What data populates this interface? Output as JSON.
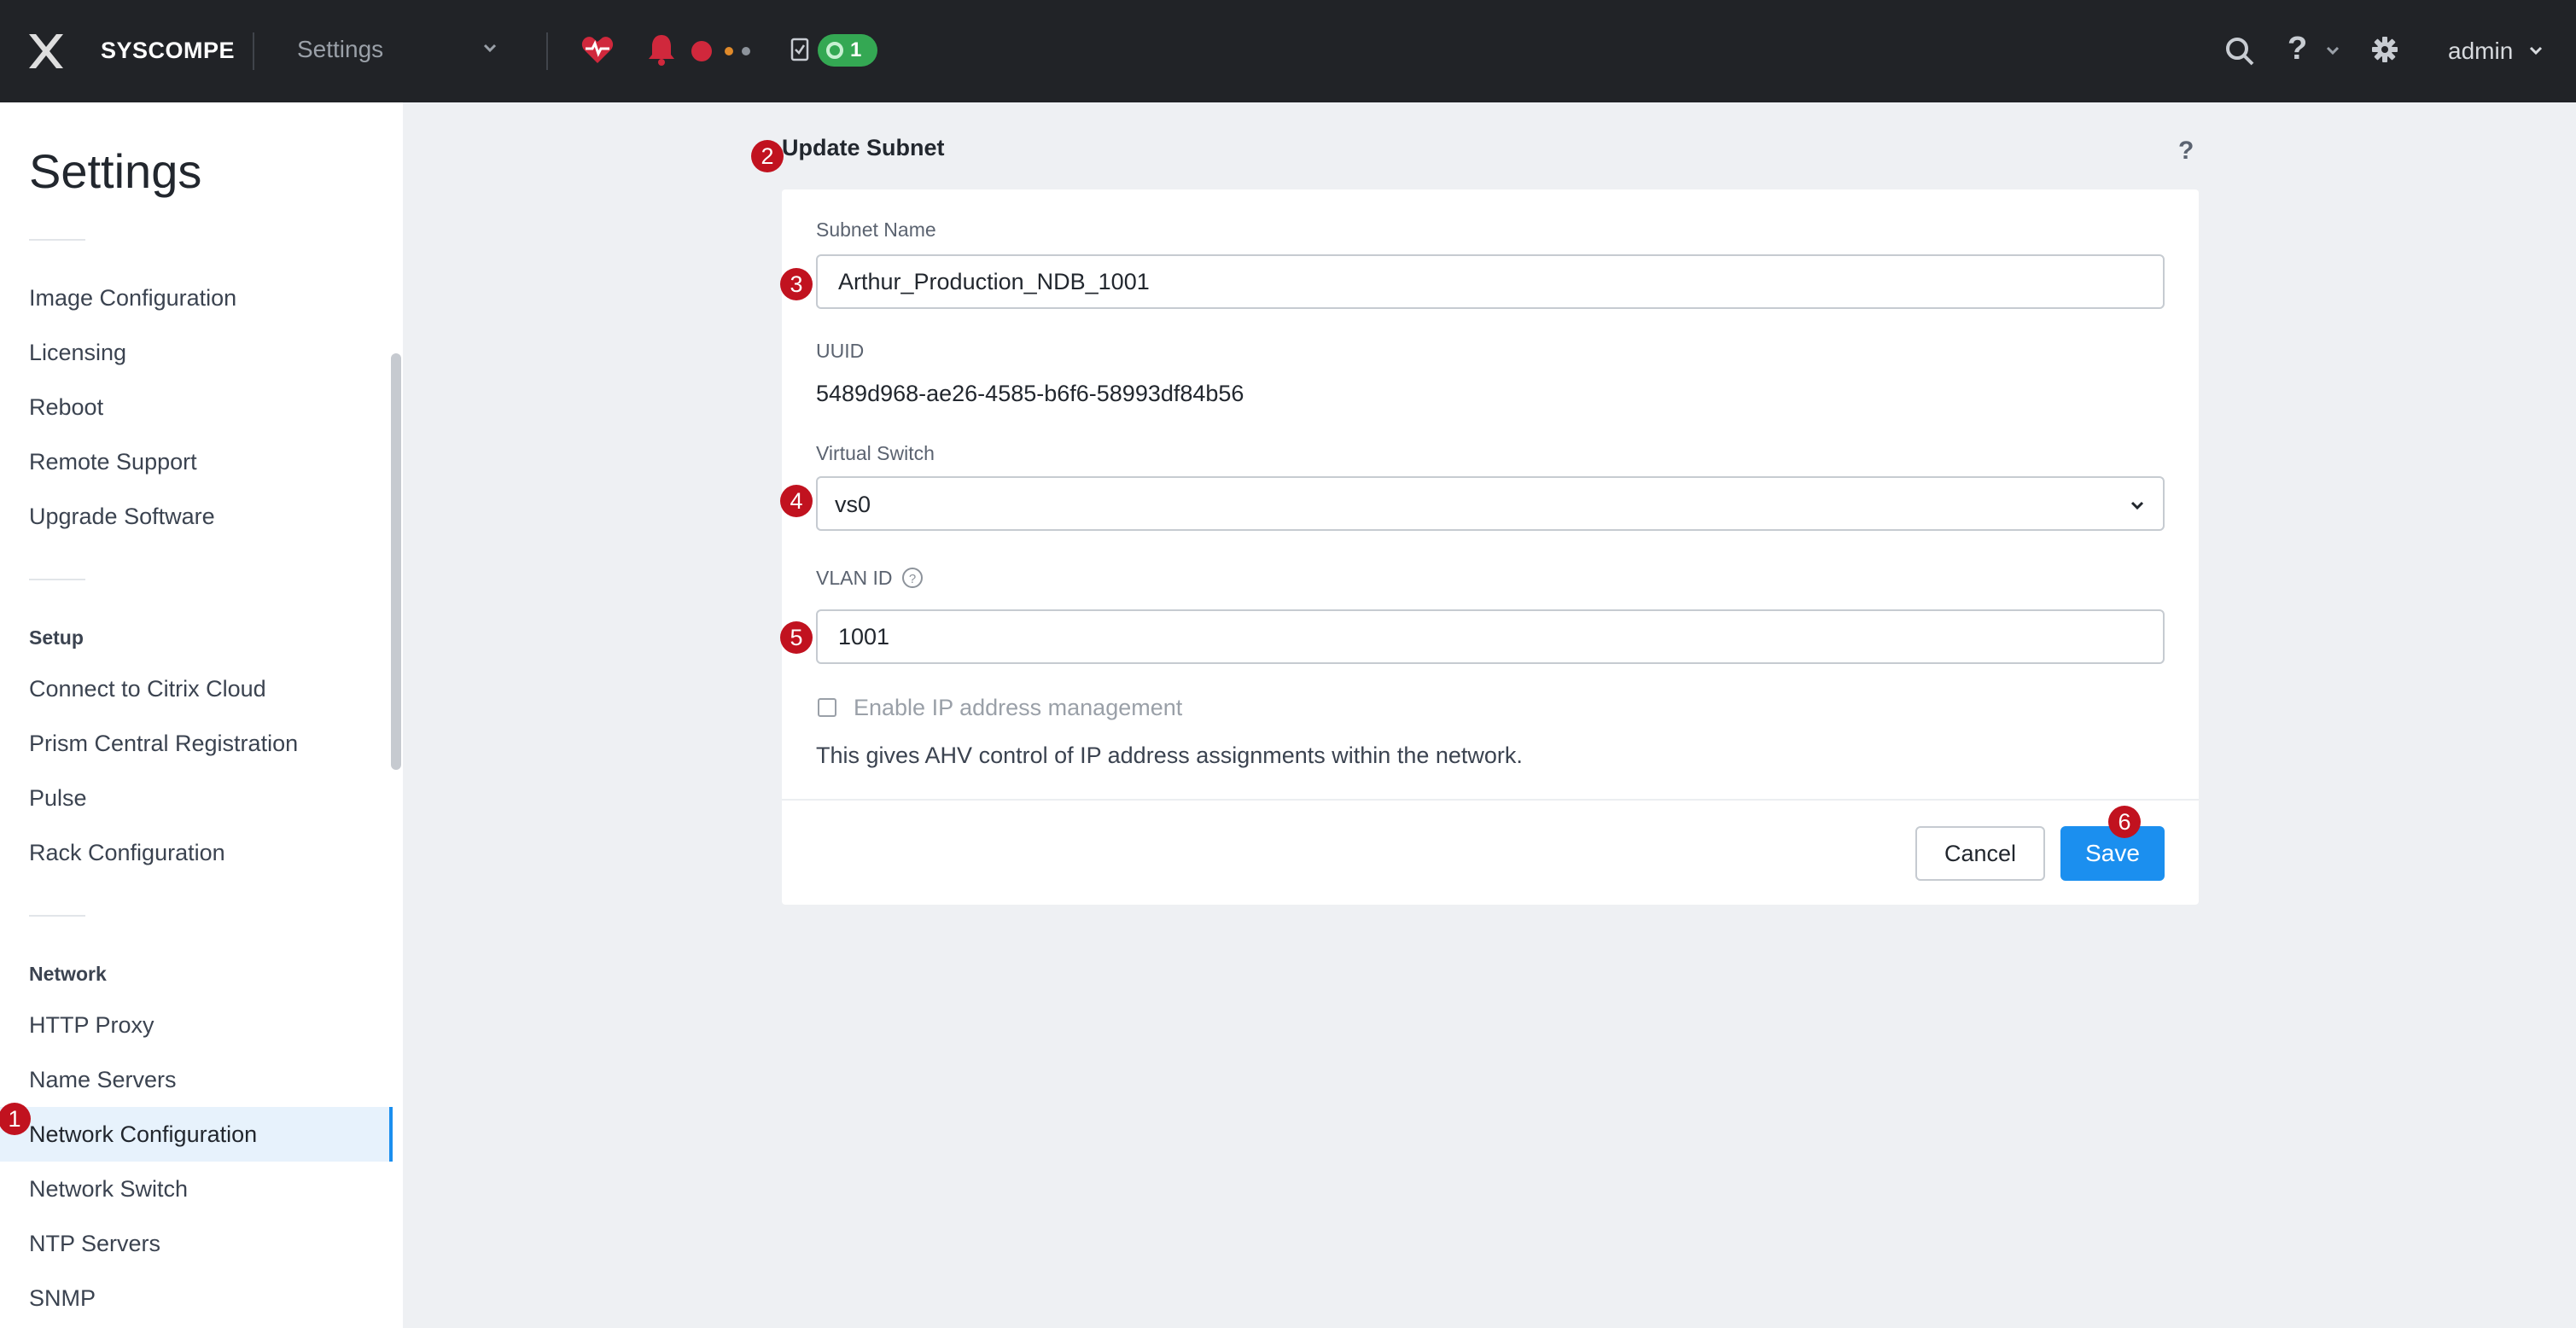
{
  "topbar": {
    "brand": "SYSCOMPE",
    "module": "Settings",
    "task_count": "1",
    "user": "admin",
    "help_label": "?"
  },
  "icons": {
    "logo": "x-logo-icon",
    "health": "heart-pulse-icon",
    "alerts": "bell-icon",
    "tasks": "clipboard-check-icon",
    "search": "search-icon",
    "settings": "gear-icon"
  },
  "colors": {
    "accent": "#1b8fef",
    "topbar": "#212327",
    "critical": "#d0283c",
    "success": "#34a853",
    "marker": "#c1121f"
  },
  "sidebar": {
    "title": "Settings",
    "items_general": [
      "Image Configuration",
      "Licensing",
      "Reboot",
      "Remote Support",
      "Upgrade Software"
    ],
    "setup_heading": "Setup",
    "items_setup": [
      "Connect to Citrix Cloud",
      "Prism Central Registration",
      "Pulse",
      "Rack Configuration"
    ],
    "network_heading": "Network",
    "items_network": [
      "HTTP Proxy",
      "Name Servers",
      "Network Configuration",
      "Network Switch",
      "NTP Servers",
      "SNMP"
    ],
    "active_item": "Network Configuration"
  },
  "dialog": {
    "title": "Update Subnet",
    "help": "?",
    "subnet_name_label": "Subnet Name",
    "subnet_name_value": "Arthur_Production_NDB_1001",
    "uuid_label": "UUID",
    "uuid_value": "5489d968-ae26-4585-b6f6-58993df84b56",
    "virtual_switch_label": "Virtual Switch",
    "virtual_switch_value": "vs0",
    "vlan_label": "VLAN ID",
    "vlan_value": "1001",
    "ipam_label": "Enable IP address management",
    "ipam_checked": false,
    "ipam_help": "This gives AHV control of IP address assignments within the network.",
    "cancel_label": "Cancel",
    "save_label": "Save"
  },
  "markers": [
    "1",
    "2",
    "3",
    "4",
    "5",
    "6"
  ]
}
